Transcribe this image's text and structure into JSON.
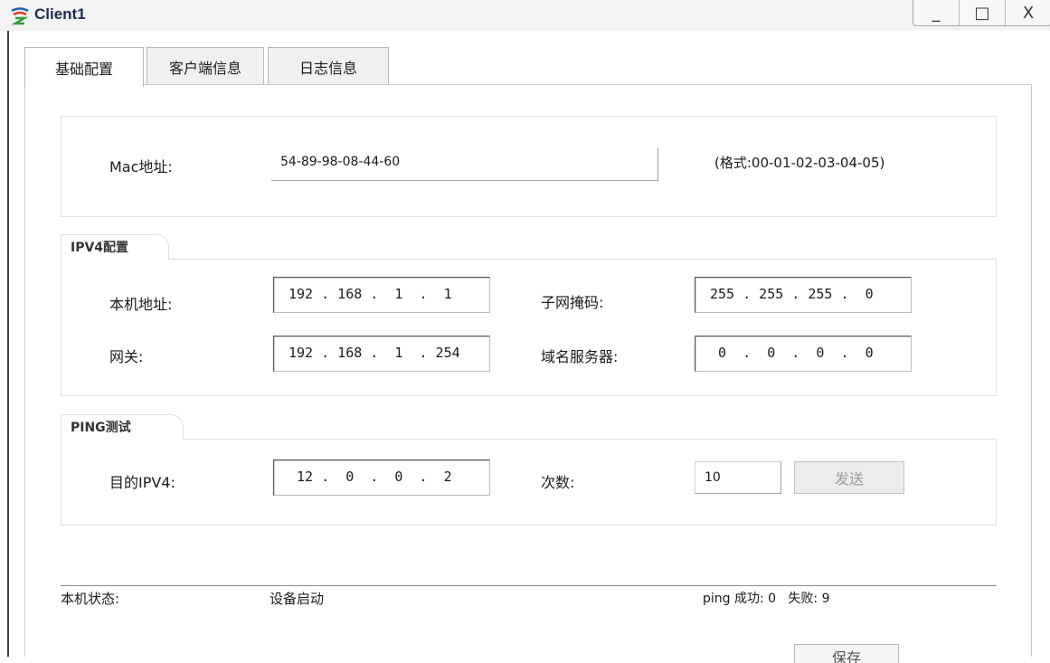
{
  "window": {
    "title": "Client1",
    "app_icon": "huawei-logo-icon",
    "controls": [
      "_",
      "□",
      "X"
    ]
  },
  "tabs": [
    {
      "label": "基础配置",
      "active": true
    },
    {
      "label": "客户端信息",
      "active": false
    },
    {
      "label": "日志信息",
      "active": false
    }
  ],
  "mac": {
    "label": "Mac地址:",
    "value": "54-89-98-08-44-60",
    "hint": "(格式:00-01-02-03-04-05)"
  },
  "ipv4": {
    "group_label": "IPV4配置",
    "host_label": "本机地址:",
    "host_value": "192 . 168 .  1  .  1",
    "mask_label": "子网掩码:",
    "mask_value": "255 . 255 . 255 .  0",
    "gateway_label": "网关:",
    "gateway_value": "192 . 168 .  1  . 254",
    "dns_label": "域名服务器:",
    "dns_value": " 0  .  0  .  0  .  0"
  },
  "ping": {
    "group_label": "PING测试",
    "dest_label": "目的IPV4:",
    "dest_value": " 12 .  0  .  0  .  2",
    "count_label": "次数:",
    "count_value": "10",
    "send_label": "发送"
  },
  "status": {
    "label": "本机状态:",
    "value": "设备启动",
    "ping_result": "ping 成功: 0   失败: 9"
  },
  "bottom_button": {
    "label": "保存"
  },
  "colors": {
    "title_text": "#1d2b4f",
    "panel_border": "#c9c9c9",
    "disabled_text": "#9a9a9a"
  }
}
